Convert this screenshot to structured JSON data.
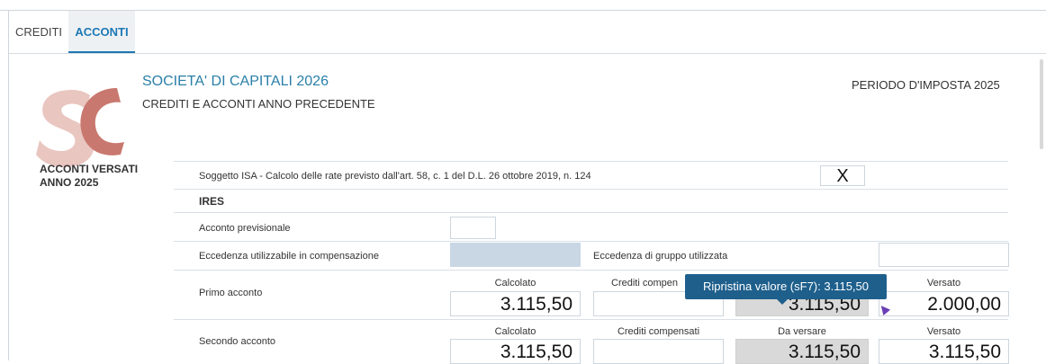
{
  "tabs": [
    {
      "label": "CREDITI"
    },
    {
      "label": "ACCONTI"
    }
  ],
  "header": {
    "title": "SOCIETA' DI CAPITALI 2026",
    "subtitle": "CREDITI E ACCONTI ANNO PRECEDENTE",
    "periodo": "PERIODO D'IMPOSTA 2025"
  },
  "logo": {
    "text": "SC",
    "color": "#c9786f"
  },
  "side": {
    "line1": "ACCONTI VERSATI",
    "line2": "ANNO 2025"
  },
  "isa": {
    "label": "Soggetto ISA - Calcolo delle rate previsto dall'art. 58, c. 1 del D.L. 26 ottobre 2019, n. 124",
    "value": "X"
  },
  "ires": {
    "label": "IRES"
  },
  "acconto_previsionale": {
    "label": "Acconto previsionale",
    "value": ""
  },
  "eccedenza": {
    "label": "Eccedenza utilizzabile in compensazione",
    "value": ""
  },
  "eccedenza_gruppo": {
    "label": "Eccedenza di gruppo utilizzata",
    "value": ""
  },
  "primo": {
    "label": "Primo acconto",
    "h_calcolato": "Calcolato",
    "h_crediti": "Crediti compen",
    "h_versato": "Versato",
    "calcolato": "3.115,50",
    "crediti": "",
    "da_versare": "3.115,50",
    "versato": "2.000,00"
  },
  "secondo": {
    "label": "Secondo acconto",
    "h_calcolato": "Calcolato",
    "h_crediti": "Crediti compensati",
    "h_da_versare": "Da versare",
    "h_versato": "Versato",
    "calcolato": "3.115,50",
    "crediti": "",
    "da_versare": "3.115,50",
    "versato": "3.115,50"
  },
  "tooltip": {
    "text": "Ripristina valore (sF7): 3.115,50"
  },
  "colors": {
    "accent": "#1e78b4",
    "tooltip_bg": "#1e5f8c"
  }
}
